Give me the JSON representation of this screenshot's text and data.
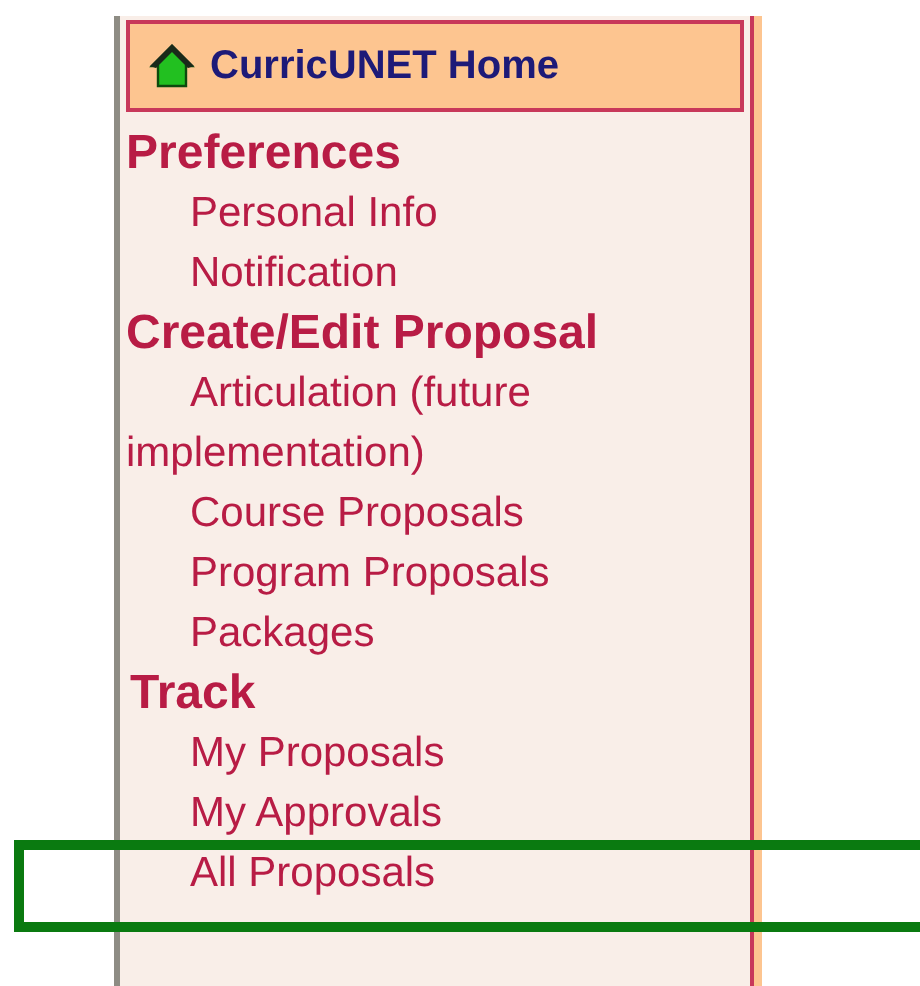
{
  "home_link": {
    "label": "CurricUNET Home"
  },
  "sections": [
    {
      "heading": "Preferences",
      "items": [
        {
          "label": "Personal Info",
          "highlighted": false
        },
        {
          "label": "Notification",
          "highlighted": false
        }
      ]
    },
    {
      "heading": "Create/Edit Proposal",
      "items": [
        {
          "label": "Articulation (future implementation)",
          "highlighted": false
        },
        {
          "label": "Course Proposals",
          "highlighted": false
        },
        {
          "label": "Program Proposals",
          "highlighted": false
        },
        {
          "label": "Packages",
          "highlighted": false
        }
      ]
    },
    {
      "heading": "Track",
      "items": [
        {
          "label": "My Proposals",
          "highlighted": false
        },
        {
          "label": "My Approvals",
          "highlighted": false
        },
        {
          "label": "All Proposals",
          "highlighted": true
        }
      ]
    }
  ]
}
